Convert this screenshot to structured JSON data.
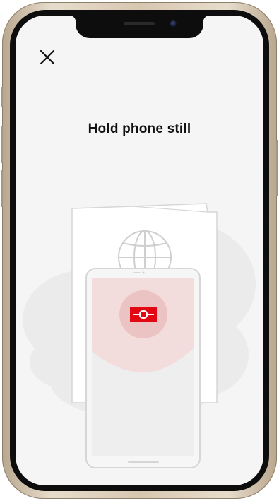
{
  "screen": {
    "title": "Hold phone still",
    "close_icon": "close-icon"
  },
  "illustration": {
    "description_icons": [
      "passport-icon",
      "globe-icon",
      "phone-outline-icon",
      "nfc-chip-icon"
    ],
    "accent_color": "#e30613",
    "scan_glow_color": "#f2d6d6"
  },
  "theme": {
    "background": "#f5f5f5",
    "text_color": "#111111",
    "frame_color": "#d7c7b1"
  }
}
